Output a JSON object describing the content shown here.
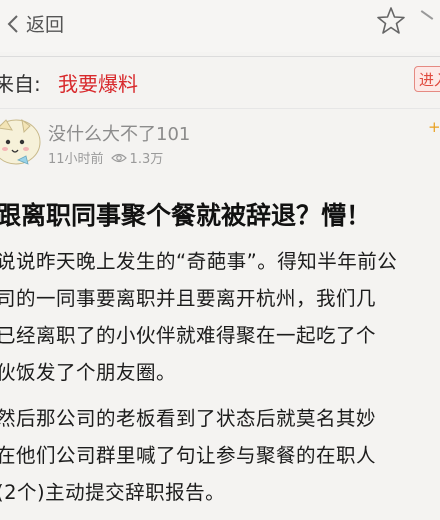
{
  "header": {
    "back_label": "返回"
  },
  "source": {
    "label": "来自:",
    "name": "我要爆料",
    "enter_button_label": "进入"
  },
  "post": {
    "username": "没什么大不了101",
    "time": "11小时前",
    "views": "1.3万",
    "follow_label": "+",
    "title": "跟离职同事聚个餐就被辞退？懵！",
    "lines": [
      "说说昨天晚上发生的“奇葩事”。得知半年前公",
      "司的一同事要离职并且要离开杭州，我们几",
      "已经离职了的小伙伴就难得聚在一起吃了个",
      "伙饭发了个朋友圈。",
      "然后那公司的老板看到了状态后就莫名其妙",
      "在他们公司群里喊了句让参与聚餐的在职人",
      "(2个)主动提交辞职报告。"
    ]
  },
  "colors": {
    "accent": "#d8292c",
    "muted_text": "#8c8c8c",
    "background": "#f4f3f1"
  }
}
